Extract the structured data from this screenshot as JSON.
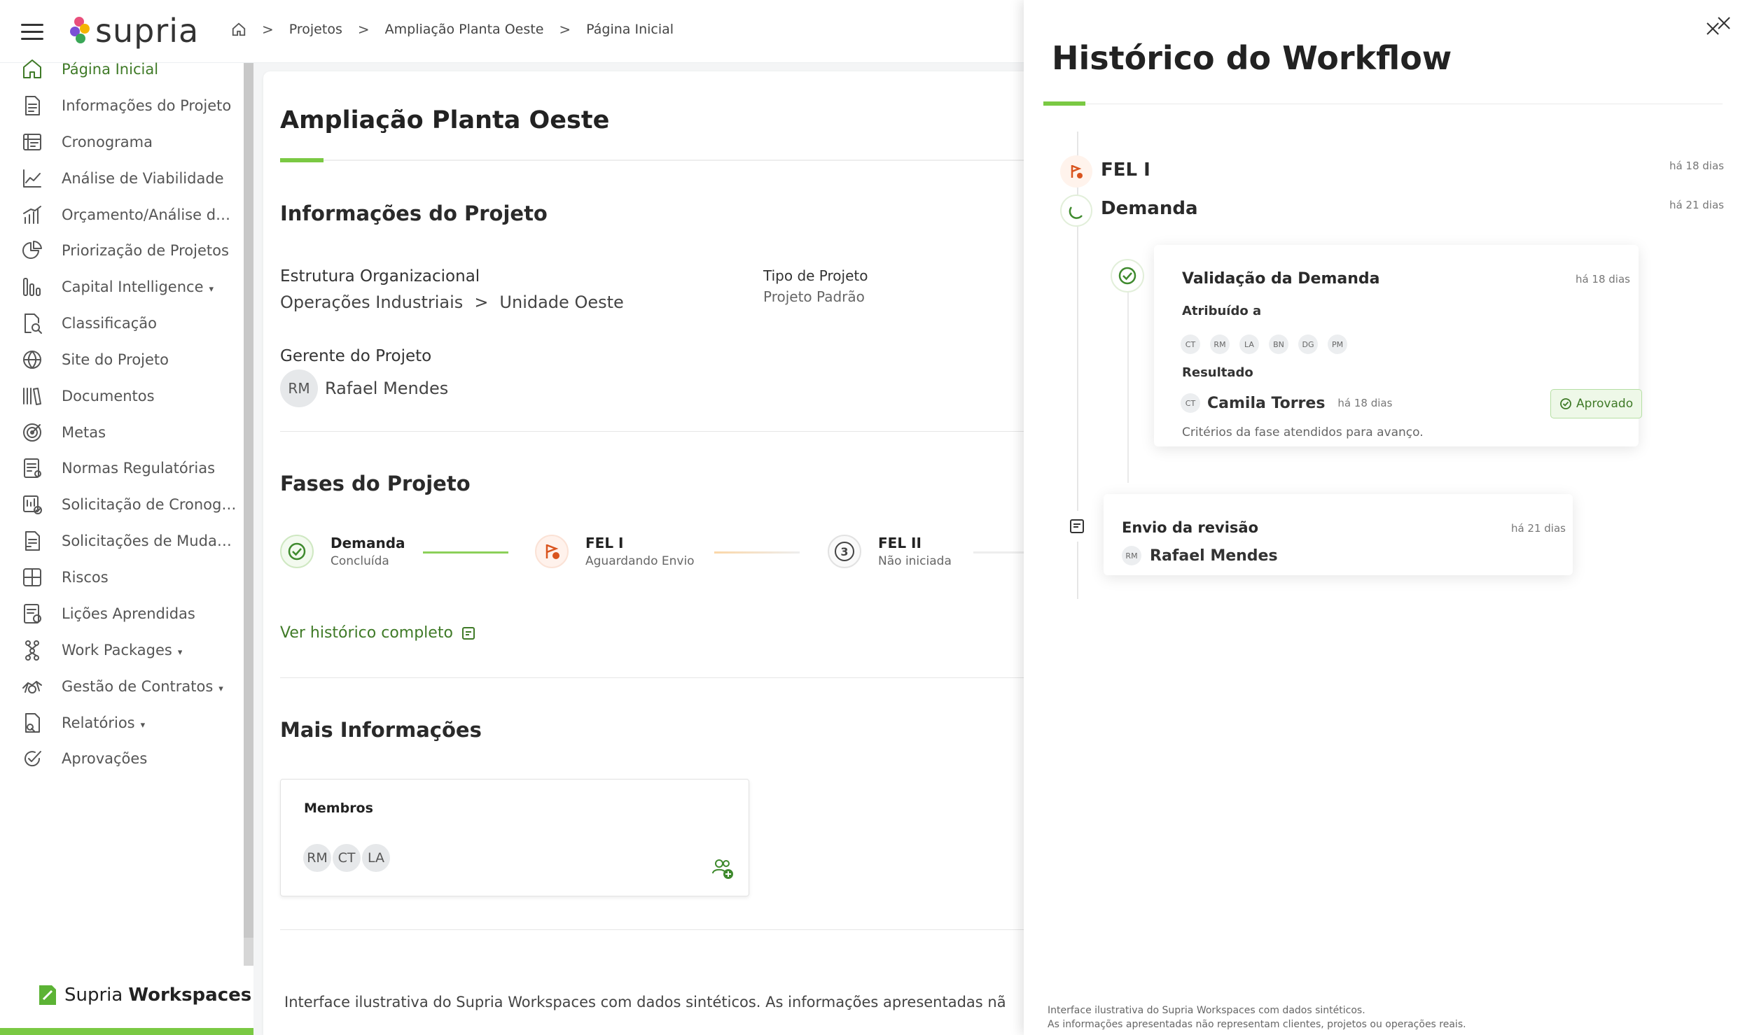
{
  "topbar": {
    "brand": "supria",
    "breadcrumb": [
      "Projetos",
      "Ampliação Planta Oeste",
      "Página Inicial"
    ],
    "separator": ">"
  },
  "sidebar": {
    "items": [
      {
        "label": "Página Inicial",
        "icon": "home-icon",
        "active": true
      },
      {
        "label": "Informações do Projeto",
        "icon": "document-icon"
      },
      {
        "label": "Cronograma",
        "icon": "schedule-icon"
      },
      {
        "label": "Análise de Viabilidade",
        "icon": "trend-chart-icon"
      },
      {
        "label": "Orçamento/Análise de ...",
        "icon": "bar-chart-icon"
      },
      {
        "label": "Priorização de Projetos",
        "icon": "pie-chart-icon"
      },
      {
        "label": "Capital Intelligence",
        "icon": "columns-icon",
        "caret": "▾"
      },
      {
        "label": "Classificação",
        "icon": "search-doc-icon"
      },
      {
        "label": "Site do Projeto",
        "icon": "globe-icon"
      },
      {
        "label": "Documentos",
        "icon": "library-icon"
      },
      {
        "label": "Metas",
        "icon": "target-icon"
      },
      {
        "label": "Normas Regulatórias",
        "icon": "checklist-icon"
      },
      {
        "label": "Solicitação de Cronogra...",
        "icon": "schedule-check-icon"
      },
      {
        "label": "Solicitações de Mudança",
        "icon": "change-doc-icon"
      },
      {
        "label": "Riscos",
        "icon": "grid-icon"
      },
      {
        "label": "Lições Aprendidas",
        "icon": "lessons-icon"
      },
      {
        "label": "Work Packages",
        "icon": "hierarchy-icon",
        "caret": "▾"
      },
      {
        "label": "Gestão de Contratos",
        "icon": "handshake-icon",
        "caret": "▾"
      },
      {
        "label": "Relatórios",
        "icon": "report-icon",
        "caret": "▾"
      },
      {
        "label": "Aprovações",
        "icon": "approval-icon"
      }
    ],
    "workspace_prefix": "Supria",
    "workspace_suffix": "Workspaces"
  },
  "main": {
    "title": "Ampliação Planta Oeste",
    "project_info": {
      "heading": "Informações do Projeto",
      "org_label": "Estrutura Organizacional",
      "org_path_1": "Operações Industriais",
      "org_sep": ">",
      "org_path_2": "Unidade Oeste",
      "type_label": "Tipo de Projeto",
      "type_value": "Projeto Padrão",
      "manager_label": "Gerente do Projeto",
      "manager_initials": "RM",
      "manager_name": "Rafael Mendes"
    },
    "phases": {
      "heading": "Fases do Projeto",
      "items": [
        {
          "name": "Demanda",
          "status": "Concluída"
        },
        {
          "name": "FEL I",
          "status": "Aguardando Envio"
        },
        {
          "name": "FEL II",
          "status": "Não iniciada",
          "number": "3"
        }
      ],
      "link": "Ver histórico completo"
    },
    "more_info": {
      "heading": "Mais Informações",
      "members_title": "Membros",
      "members": [
        "RM",
        "CT",
        "LA"
      ]
    },
    "footer": "Interface ilustrativa do Supria Workspaces com dados sintéticos. As informações apresentadas nã"
  },
  "panel": {
    "title": "Histórico do Workflow",
    "events": [
      {
        "title": "FEL I",
        "time": "há 18 dias"
      },
      {
        "title": "Demanda",
        "time": "há 21 dias"
      }
    ],
    "validation": {
      "title": "Validação da Demanda",
      "time": "há 18 dias",
      "assigned_label": "Atribuído a",
      "assignees": [
        "CT",
        "RM",
        "LA",
        "BN",
        "DG",
        "PM"
      ],
      "result_label": "Resultado",
      "result_initials": "CT",
      "result_name": "Camila Torres",
      "result_time": "há 18 dias",
      "badge": "Aprovado",
      "comment": "Critérios da fase atendidos para avanço."
    },
    "review": {
      "title": "Envio da revisão",
      "time": "há 21 dias",
      "initials": "RM",
      "name": "Rafael Mendes"
    },
    "footer_line1": "Interface ilustrativa do Supria Workspaces com dados sintéticos.",
    "footer_line2": "As informações apresentadas não representam clientes, projetos ou operações reais."
  },
  "colors": {
    "accent_green": "#7ac943",
    "text_green": "#3f7a27",
    "warning_orange": "#d9541e"
  }
}
